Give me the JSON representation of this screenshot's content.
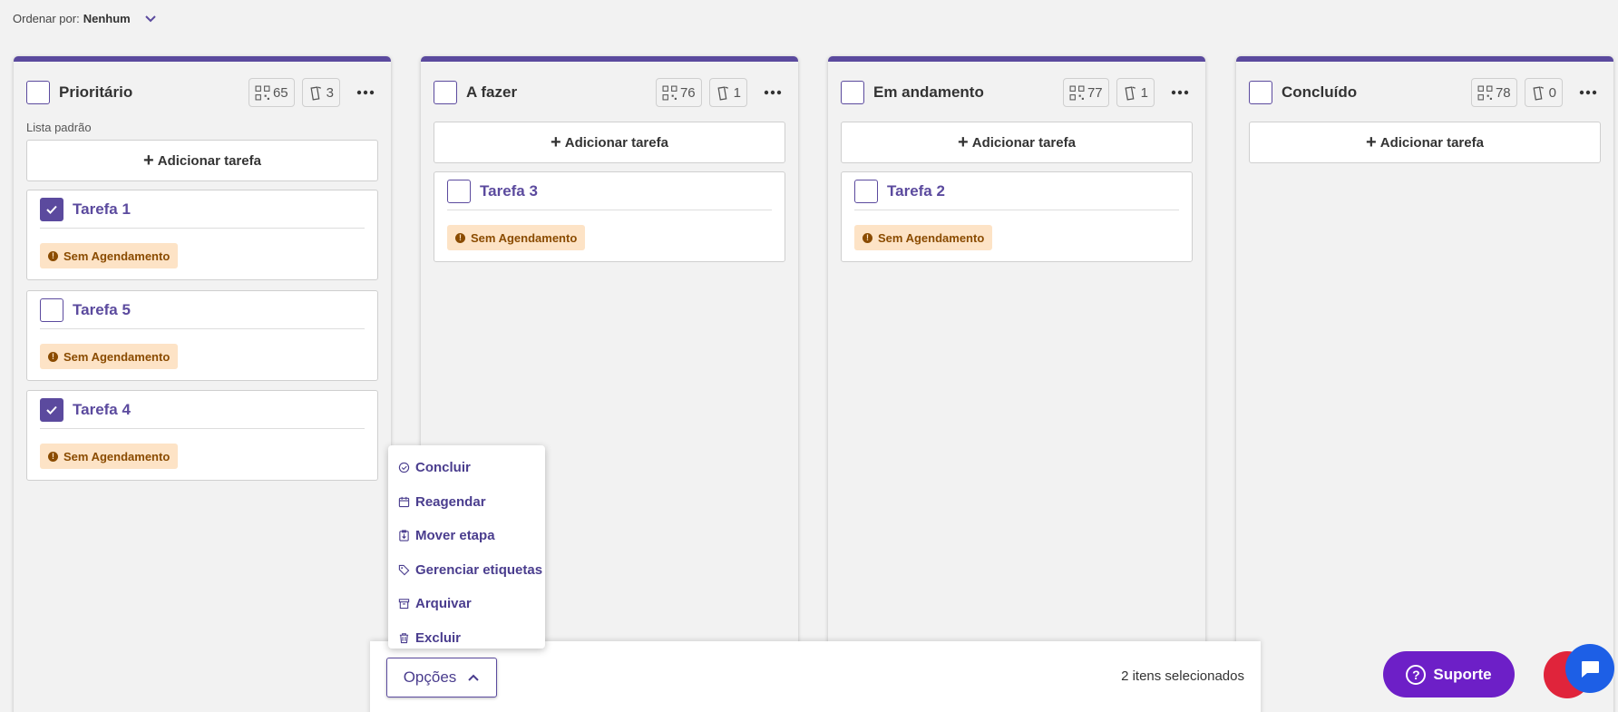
{
  "sort": {
    "label": "Ordenar por:",
    "value": "Nenhum"
  },
  "columns": [
    {
      "title": "Prioritário",
      "subtitle": "Lista padrão",
      "count_a": "65",
      "count_b": "3",
      "add_label": "Adicionar tarefa",
      "cards": [
        {
          "name": "Tarefa 1",
          "checked": true,
          "badge": "Sem Agendamento"
        },
        {
          "name": "Tarefa 5",
          "checked": false,
          "badge": "Sem Agendamento"
        },
        {
          "name": "Tarefa 4",
          "checked": true,
          "badge": "Sem Agendamento"
        }
      ]
    },
    {
      "title": "A fazer",
      "count_a": "76",
      "count_b": "1",
      "add_label": "Adicionar tarefa",
      "cards": [
        {
          "name": "Tarefa 3",
          "checked": false,
          "badge": "Sem Agendamento"
        }
      ]
    },
    {
      "title": "Em andamento",
      "count_a": "77",
      "count_b": "1",
      "add_label": "Adicionar tarefa",
      "cards": [
        {
          "name": "Tarefa 2",
          "checked": false,
          "badge": "Sem Agendamento"
        }
      ]
    },
    {
      "title": "Concluído",
      "count_a": "78",
      "count_b": "0",
      "add_label": "Adicionar tarefa",
      "cards": []
    }
  ],
  "menu": {
    "items": [
      {
        "label": "Concluir",
        "icon": "check-circle-icon"
      },
      {
        "label": "Reagendar",
        "icon": "calendar-icon"
      },
      {
        "label": "Mover etapa",
        "icon": "clipboard-move-icon"
      },
      {
        "label": "Gerenciar etiquetas",
        "icon": "tag-icon"
      },
      {
        "label": "Arquivar",
        "icon": "archive-icon"
      },
      {
        "label": "Excluir",
        "icon": "trash-icon"
      }
    ]
  },
  "bottom_bar": {
    "options_label": "Opções",
    "selected_text": "2 itens selecionados"
  },
  "support": {
    "label": "Suporte"
  },
  "colors": {
    "accent": "#5b4a9e",
    "badge_bg": "#fde3c6",
    "badge_text": "#8a4b00",
    "support_bg": "#6d1fc7",
    "fab_red": "#e0243b",
    "fab_blue": "#1d5fe6"
  }
}
